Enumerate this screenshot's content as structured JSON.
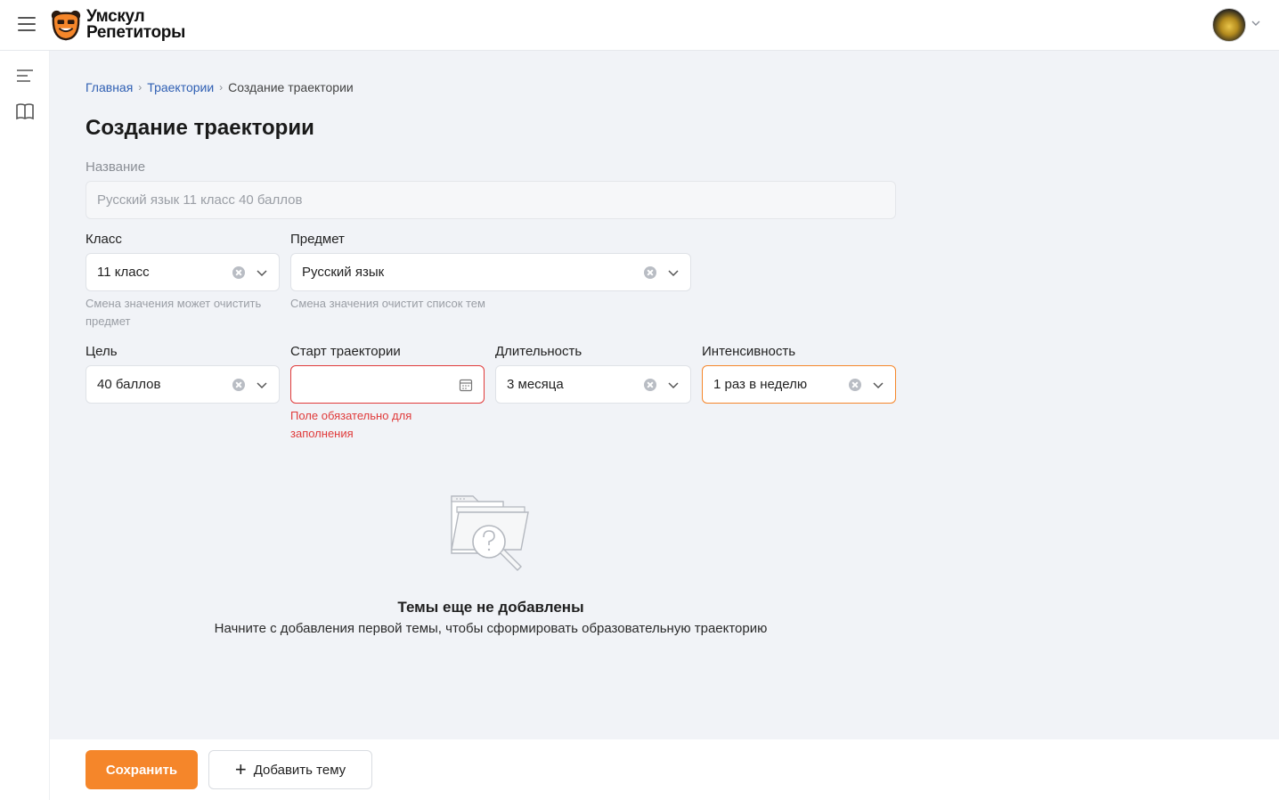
{
  "header": {
    "logo_line1": "Умскул",
    "logo_line2": "Репетиторы"
  },
  "breadcrumb": {
    "home": "Главная",
    "trajectories": "Траектории",
    "current": "Создание траектории"
  },
  "page_title": "Создание траектории",
  "form": {
    "name": {
      "label": "Название",
      "placeholder": "Русский язык 11 класс 40 баллов"
    },
    "grade": {
      "label": "Класс",
      "value": "11 класс",
      "hint": "Смена значения может очистить предмет"
    },
    "subject": {
      "label": "Предмет",
      "value": "Русский язык",
      "hint": "Смена значения очистит список тем"
    },
    "goal": {
      "label": "Цель",
      "value": "40 баллов"
    },
    "start": {
      "label": "Старт траектории",
      "value": "",
      "error": "Поле обязательно для заполнения"
    },
    "duration": {
      "label": "Длительность",
      "value": "3 месяца"
    },
    "intensity": {
      "label": "Интенсивность",
      "value": "1 раз в неделю"
    }
  },
  "empty_state": {
    "title": "Темы еще не добавлены",
    "subtitle": "Начните с добавления первой темы, чтобы сформировать образовательную траекторию"
  },
  "footer": {
    "save": "Сохранить",
    "add_topic": "Добавить тему"
  },
  "colors": {
    "accent": "#f5862a",
    "link": "#2f5fb3",
    "error": "#e03a3a",
    "page_bg": "#f1f3f7"
  }
}
